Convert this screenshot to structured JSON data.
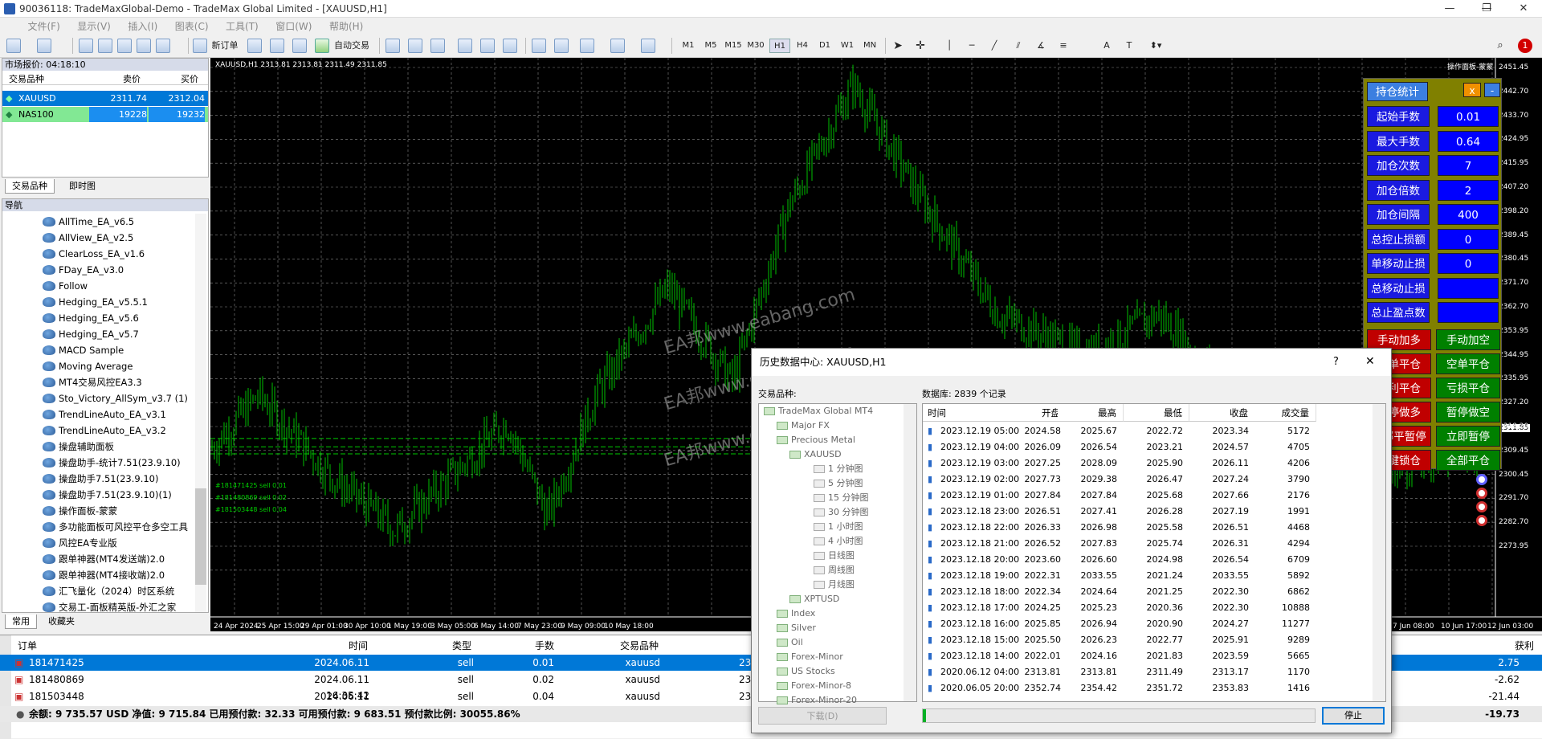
{
  "window": {
    "title": "90036118: TradeMaxGlobal-Demo - TradeMax Global Limited - [XAUUSD,H1]",
    "min": "—",
    "restore": "❐",
    "close": "✕"
  },
  "menu": [
    "文件(F)",
    "显示(V)",
    "插入(I)",
    "图表(C)",
    "工具(T)",
    "窗口(W)",
    "帮助(H)"
  ],
  "toolbar": {
    "new_order": "新订单",
    "auto_trade": "自动交易",
    "timeframes": [
      "M1",
      "M5",
      "M15",
      "M30",
      "H1",
      "H4",
      "D1",
      "W1",
      "MN"
    ],
    "selected_tf": "H1",
    "alert_count": "1"
  },
  "market_watch": {
    "title": "市场报价: 04:18:10",
    "col_symbol": "交易品种",
    "col_bid": "卖价",
    "col_ask": "买价",
    "rows": [
      {
        "symbol": "XAUUSD",
        "bid": "2311.74",
        "ask": "2312.04"
      },
      {
        "symbol": "NAS100",
        "bid": "19228",
        "ask": "19232"
      }
    ],
    "tabs": [
      "交易品种",
      "即时图"
    ]
  },
  "navigator": {
    "title": "导航",
    "items": [
      "AllTime_EA_v6.5",
      "AllView_EA_v2.5",
      "ClearLoss_EA_v1.6",
      "FDay_EA_v3.0",
      "Follow",
      "Hedging_EA_v5.5.1",
      "Hedging_EA_v5.6",
      "Hedging_EA_v5.7",
      "MACD Sample",
      "Moving Average",
      "MT4交易风控EA3.3",
      "Sto_Victory_AllSym_v3.7 (1)",
      "TrendLineAuto_EA_v3.1",
      "TrendLineAuto_EA_v3.2",
      "操盘辅助面板",
      "操盘助手-统计7.51(23.9.10)",
      "操盘助手7.51(23.9.10)",
      "操盘助手7.51(23.9.10)(1)",
      "操作面板-蒙蒙",
      "多功能面板可风控平仓多空工具",
      "风控EA专业版",
      "跟单神器(MT4发送端)2.0",
      "跟单神器(MT4接收端)2.0",
      "汇飞量化（2024）时区系统",
      "交易工-面板精英版-外汇之家"
    ],
    "tabs": [
      "常用",
      "收藏夹"
    ]
  },
  "chart": {
    "header": "XAUUSD,H1  2313.81 2313.81 2311.49 2311.85",
    "corner": "操作面板-蒙蒙",
    "prices": [
      "2451.45",
      "2442.70",
      "2433.70",
      "2424.95",
      "2415.95",
      "2407.20",
      "2398.20",
      "2389.45",
      "2380.45",
      "2371.70",
      "2362.70",
      "2353.95",
      "2344.95",
      "2335.95",
      "2327.20",
      "2318.20",
      "2309.45",
      "2300.45",
      "2291.70",
      "2282.70",
      "2273.95"
    ],
    "current_price": "2311.85",
    "dates": [
      "24 Apr 2024",
      "25 Apr 15:00",
      "29 Apr 01:00",
      "30 Apr 10:00",
      "1 May 19:00",
      "3 May 05:00",
      "6 May 14:00",
      "7 May 23:00",
      "9 May 09:00",
      "10 May 18:00",
      "7 Jun 08:00",
      "10 Jun 17:00",
      "12 Jun 03:00"
    ],
    "order_lines": [
      "#181471425 sell 0.01",
      "#181480869 sell 0.02",
      "#181503448 sell 0.04"
    ],
    "watermark": "EA邦www.eabang.com"
  },
  "panel": {
    "title": "持仓统计",
    "x": "x",
    "min": "-",
    "fields": [
      {
        "label": "起始手数",
        "value": "0.01"
      },
      {
        "label": "最大手数",
        "value": "0.64"
      },
      {
        "label": "加仓次数",
        "value": "7"
      },
      {
        "label": "加仓倍数",
        "value": "2"
      },
      {
        "label": "加仓间隔",
        "value": "400"
      },
      {
        "label": "总控止损额",
        "value": "0"
      },
      {
        "label": "单移动止损",
        "value": "0"
      },
      {
        "label": "总移动止损",
        "value": ""
      },
      {
        "label": "总止盈点数",
        "value": ""
      }
    ],
    "buttons": [
      [
        "手动加多",
        "手动加空"
      ],
      [
        "多单平仓",
        "空单平仓"
      ],
      [
        "盈利平仓",
        "亏损平仓"
      ],
      [
        "暂停做多",
        "暂停做空"
      ],
      [
        "全部平暂停",
        "立即暂停"
      ],
      [
        "一键锁仓",
        "全部平仓"
      ]
    ]
  },
  "dialog": {
    "title": "历史数据中心: XAUUSD,H1",
    "help": "?",
    "close": "✕",
    "symbols_label": "交易品种:",
    "db_label": "数据库: 2839 个记录",
    "tree": [
      {
        "t": "TradeMax Global MT4",
        "l": 0
      },
      {
        "t": "Major FX",
        "l": 1
      },
      {
        "t": "Precious Metal",
        "l": 1
      },
      {
        "t": "XAUUSD",
        "l": 2
      },
      {
        "t": "1 分钟图",
        "l": 3
      },
      {
        "t": "5 分钟图",
        "l": 3
      },
      {
        "t": "15 分钟图",
        "l": 3
      },
      {
        "t": "30 分钟图",
        "l": 3
      },
      {
        "t": "1 小时图",
        "l": 3
      },
      {
        "t": "4 小时图",
        "l": 3
      },
      {
        "t": "日线图",
        "l": 3
      },
      {
        "t": "周线图",
        "l": 3
      },
      {
        "t": "月线图",
        "l": 3
      },
      {
        "t": "XPTUSD",
        "l": 2
      },
      {
        "t": "Index",
        "l": 1
      },
      {
        "t": "Silver",
        "l": 1
      },
      {
        "t": "Oil",
        "l": 1
      },
      {
        "t": "Forex-Minor",
        "l": 1
      },
      {
        "t": "US Stocks",
        "l": 1
      },
      {
        "t": "Forex-Minor-8",
        "l": 1
      },
      {
        "t": "Forex-Minor-20",
        "l": 1
      }
    ],
    "cols": [
      "时间",
      "开盘",
      "最高",
      "最低",
      "收盘",
      "成交量"
    ],
    "rows": [
      [
        "2023.12.19 05:00",
        "2024.58",
        "2025.67",
        "2022.72",
        "2023.34",
        "5172"
      ],
      [
        "2023.12.19 04:00",
        "2026.09",
        "2026.54",
        "2023.21",
        "2024.57",
        "4705"
      ],
      [
        "2023.12.19 03:00",
        "2027.25",
        "2028.09",
        "2025.90",
        "2026.11",
        "4206"
      ],
      [
        "2023.12.19 02:00",
        "2027.73",
        "2029.38",
        "2026.47",
        "2027.24",
        "3790"
      ],
      [
        "2023.12.19 01:00",
        "2027.84",
        "2027.84",
        "2025.68",
        "2027.66",
        "2176"
      ],
      [
        "2023.12.18 23:00",
        "2026.51",
        "2027.41",
        "2026.28",
        "2027.19",
        "1991"
      ],
      [
        "2023.12.18 22:00",
        "2026.33",
        "2026.98",
        "2025.58",
        "2026.51",
        "4468"
      ],
      [
        "2023.12.18 21:00",
        "2026.52",
        "2027.83",
        "2025.74",
        "2026.31",
        "4294"
      ],
      [
        "2023.12.18 20:00",
        "2023.60",
        "2026.60",
        "2024.98",
        "2026.54",
        "6709"
      ],
      [
        "2023.12.18 19:00",
        "2022.31",
        "2033.55",
        "2021.24",
        "2033.55",
        "5892"
      ],
      [
        "2023.12.18 18:00",
        "2022.34",
        "2024.64",
        "2021.25",
        "2022.30",
        "6862"
      ],
      [
        "2023.12.18 17:00",
        "2024.25",
        "2025.23",
        "2020.36",
        "2022.30",
        "10888"
      ],
      [
        "2023.12.18 16:00",
        "2025.85",
        "2026.94",
        "2020.90",
        "2024.27",
        "11277"
      ],
      [
        "2023.12.18 15:00",
        "2025.50",
        "2026.23",
        "2022.77",
        "2025.91",
        "9289"
      ],
      [
        "2023.12.18 14:00",
        "2022.01",
        "2024.16",
        "2021.83",
        "2023.59",
        "5665"
      ],
      [
        "2020.06.12 04:00",
        "2313.81",
        "2313.81",
        "2311.49",
        "2313.17",
        "1170"
      ],
      [
        "2020.06.05 20:00",
        "2352.74",
        "2354.42",
        "2351.72",
        "2353.83",
        "1416"
      ]
    ],
    "download": "下载(D)",
    "stop": "停止"
  },
  "terminal": {
    "cols": [
      "订单",
      "时间",
      "类型",
      "手数",
      "交易品种",
      "获利"
    ],
    "rows": [
      {
        "order": "181471425",
        "time": "2024.06.11 16:01:49",
        "type": "sell",
        "lots": "0.01",
        "symbol": "xauusd",
        "price": "23",
        "profit": "2.75"
      },
      {
        "order": "181480869",
        "time": "2024.06.11 16:35:42",
        "type": "sell",
        "lots": "0.02",
        "symbol": "xauusd",
        "price": "23",
        "profit": "-2.62"
      },
      {
        "order": "181503448",
        "time": "2024.06.11 19:26:28",
        "type": "sell",
        "lots": "0.04",
        "symbol": "xauusd",
        "price": "23",
        "profit": "-21.44"
      }
    ],
    "summary": "余额: 9 735.57 USD  净值: 9 715.84  已用预付款: 32.33  可用预付款: 9 683.51  预付款比例: 30055.86%",
    "total": "-19.73"
  },
  "colors": {
    "candle": "#00c000",
    "panel_bg": "#808000",
    "panel_label": "#1a1ae0",
    "selected": "#0078d7"
  }
}
